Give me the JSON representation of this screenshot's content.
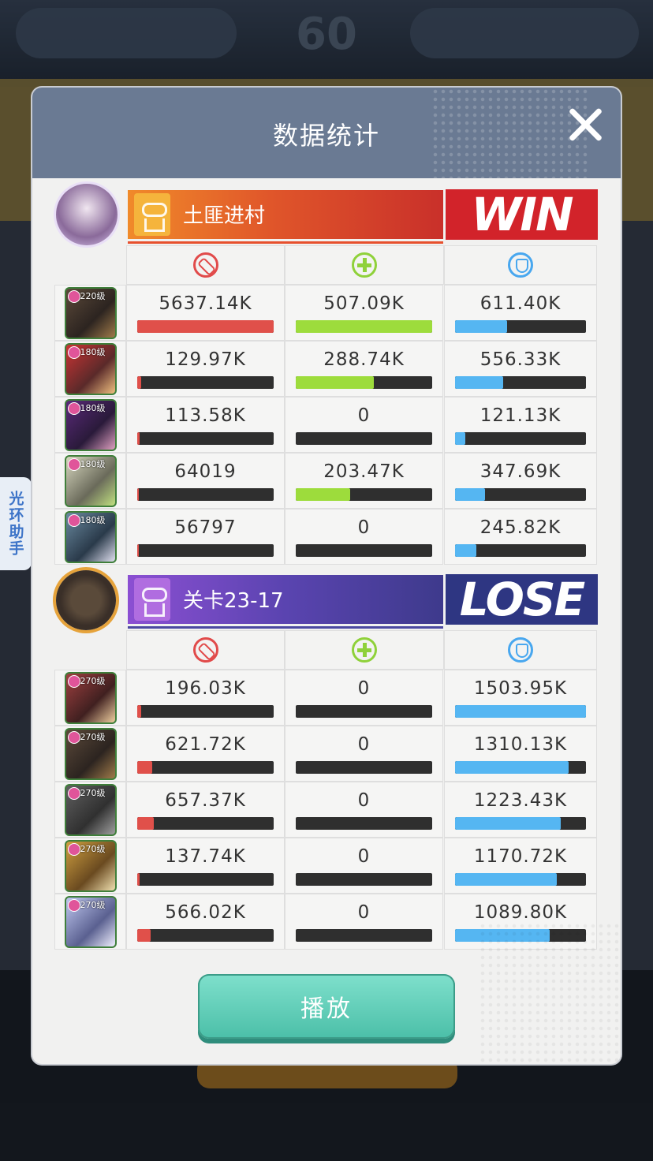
{
  "background": {
    "timer": "60"
  },
  "sidetab": {
    "label": "光环助手"
  },
  "panel": {
    "title": "数据统计",
    "play_label": "播放"
  },
  "teams": [
    {
      "name": "土匪进村",
      "result": "WIN",
      "rows": [
        {
          "level": "220级",
          "damage": "5637.14K",
          "heal": "507.09K",
          "tank": "611.40K",
          "damage_pct": 100,
          "heal_pct": 100,
          "tank_pct": 40
        },
        {
          "level": "180级",
          "damage": "129.97K",
          "heal": "288.74K",
          "tank": "556.33K",
          "damage_pct": 3,
          "heal_pct": 57,
          "tank_pct": 37
        },
        {
          "level": "180级",
          "damage": "113.58K",
          "heal": "0",
          "tank": "121.13K",
          "damage_pct": 2,
          "heal_pct": 0,
          "tank_pct": 8
        },
        {
          "level": "180级",
          "damage": "64019",
          "heal": "203.47K",
          "tank": "347.69K",
          "damage_pct": 1,
          "heal_pct": 40,
          "tank_pct": 23
        },
        {
          "level": "180级",
          "damage": "56797",
          "heal": "0",
          "tank": "245.82K",
          "damage_pct": 1,
          "heal_pct": 0,
          "tank_pct": 16
        }
      ]
    },
    {
      "name": "关卡23-17",
      "result": "LOSE",
      "rows": [
        {
          "level": "270级",
          "damage": "196.03K",
          "heal": "0",
          "tank": "1503.95K",
          "damage_pct": 3,
          "heal_pct": 0,
          "tank_pct": 100
        },
        {
          "level": "270级",
          "damage": "621.72K",
          "heal": "0",
          "tank": "1310.13K",
          "damage_pct": 11,
          "heal_pct": 0,
          "tank_pct": 87
        },
        {
          "level": "270级",
          "damage": "657.37K",
          "heal": "0",
          "tank": "1223.43K",
          "damage_pct": 12,
          "heal_pct": 0,
          "tank_pct": 81
        },
        {
          "level": "270级",
          "damage": "137.74K",
          "heal": "0",
          "tank": "1170.72K",
          "damage_pct": 2,
          "heal_pct": 0,
          "tank_pct": 78
        },
        {
          "level": "270级",
          "damage": "566.02K",
          "heal": "0",
          "tank": "1089.80K",
          "damage_pct": 10,
          "heal_pct": 0,
          "tank_pct": 72
        }
      ]
    }
  ],
  "colors": {
    "damage": "#e0504a",
    "heal": "#9ddc3c",
    "tank": "#55b6f2",
    "win": "#d2232a",
    "lose": "#2e3682"
  }
}
